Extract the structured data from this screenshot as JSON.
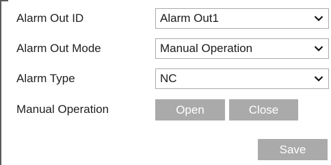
{
  "form": {
    "alarm_out_id": {
      "label": "Alarm Out ID",
      "value": "Alarm Out1"
    },
    "alarm_out_mode": {
      "label": "Alarm Out Mode",
      "value": "Manual Operation"
    },
    "alarm_type": {
      "label": "Alarm Type",
      "value": "NC"
    },
    "manual_operation": {
      "label": "Manual Operation",
      "open_label": "Open",
      "close_label": "Close"
    },
    "save_label": "Save"
  },
  "colors": {
    "button_bg": "#aaaaaa",
    "button_text": "#ffffff",
    "select_border": "#a9a9a9"
  },
  "icons": {
    "dropdown": "chevron-down-icon"
  }
}
